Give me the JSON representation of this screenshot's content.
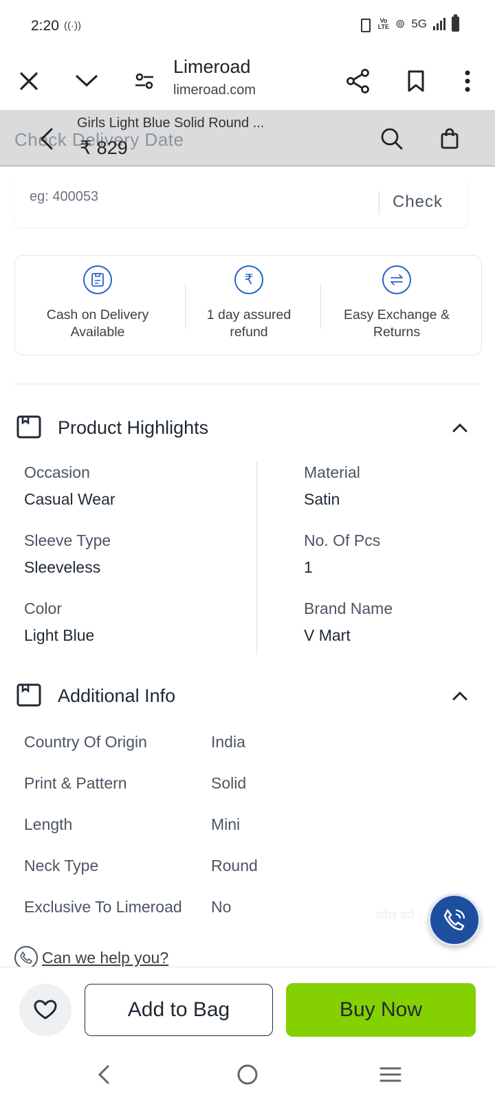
{
  "status_bar": {
    "time": "2:20",
    "network": "5G"
  },
  "custom_tab": {
    "title": "Limeroad",
    "url": "limeroad.com"
  },
  "sticky_header": {
    "ghost_text": "Check Delivery Date",
    "product_name": "Girls Light Blue Solid Round ...",
    "price": "₹ 829"
  },
  "pincode": {
    "placeholder": "eg: 400053",
    "check_label": "Check"
  },
  "benefits": [
    {
      "line1": "Cash on Delivery",
      "line2": "Available",
      "icon": "cod-icon"
    },
    {
      "line1": "1 day assured",
      "line2": "refund",
      "icon": "rupee-refund-icon"
    },
    {
      "line1": "Easy Exchange &",
      "line2": "Returns",
      "icon": "exchange-icon"
    }
  ],
  "highlights": {
    "title": "Product Highlights",
    "left": [
      {
        "label": "Occasion",
        "value": "Casual Wear"
      },
      {
        "label": "Sleeve Type",
        "value": "Sleeveless"
      },
      {
        "label": "Color",
        "value": "Light Blue"
      }
    ],
    "right": [
      {
        "label": "Material",
        "value": "Satin"
      },
      {
        "label": "No. Of Pcs",
        "value": "1"
      },
      {
        "label": "Brand Name",
        "value": "V Mart"
      }
    ]
  },
  "additional_info": {
    "title": "Additional Info",
    "rows": [
      {
        "label": "Country Of Origin",
        "value": "India"
      },
      {
        "label": "Print & Pattern",
        "value": "Solid"
      },
      {
        "label": "Length",
        "value": "Mini"
      },
      {
        "label": "Neck Type",
        "value": "Round"
      },
      {
        "label": "Exclusive To Limeroad",
        "value": "No"
      }
    ]
  },
  "help": {
    "text": "Can we help you?",
    "call_hint": "कॉल करें"
  },
  "actions": {
    "add_to_bag": "Add to Bag",
    "buy_now": "Buy Now"
  },
  "colors": {
    "accent_green": "#84d000",
    "icon_blue": "#2563c9",
    "fab_blue": "#1e4f9e"
  }
}
